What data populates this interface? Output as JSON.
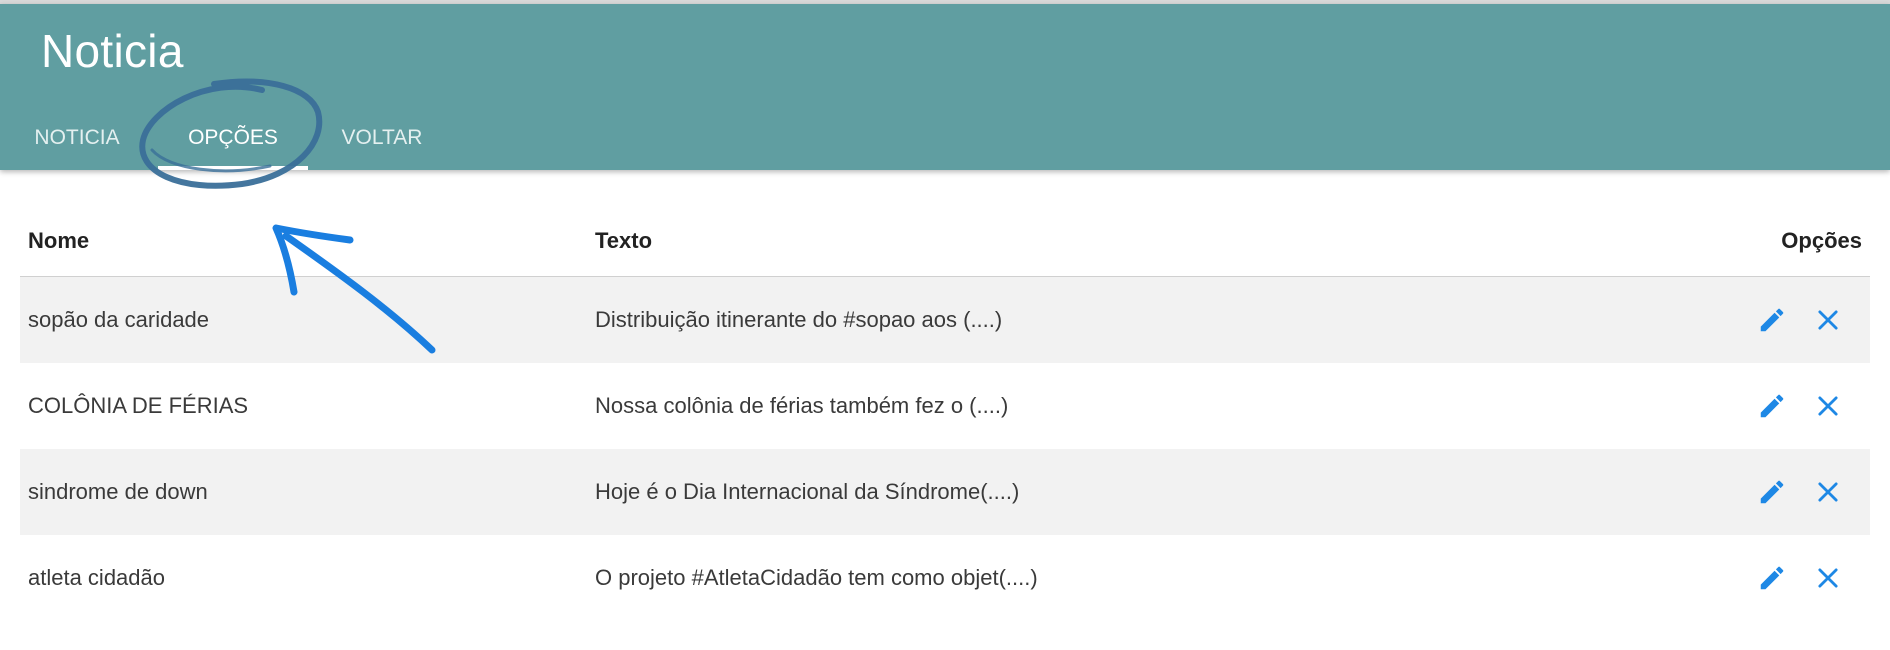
{
  "header": {
    "title": "Noticia",
    "tabs": [
      {
        "label": "NOTICIA",
        "active": false
      },
      {
        "label": "OPÇÕES",
        "active": true
      },
      {
        "label": "VOLTAR",
        "active": false
      }
    ],
    "color": "#609ea1"
  },
  "table": {
    "columns": {
      "nome": "Nome",
      "texto": "Texto",
      "opcoes": "Opções"
    },
    "rows": [
      {
        "nome": "sopão da caridade",
        "texto": "Distribuição itinerante do #sopao aos (....)"
      },
      {
        "nome": "COLÔNIA DE FÉRIAS",
        "texto": "Nossa colônia de férias também fez o (....)"
      },
      {
        "nome": "sindrome de down",
        "texto": "Hoje é o Dia Internacional da Síndrome(....)"
      },
      {
        "nome": "atleta cidadão",
        "texto": "O projeto #AtletaCidadão tem como objet(....)"
      }
    ]
  },
  "icons": {
    "edit": "pencil-icon",
    "delete": "close-icon"
  },
  "accent": "#1e88e5",
  "annotation_color": "#3a6f99",
  "arrow_color": "#1a7ee0"
}
